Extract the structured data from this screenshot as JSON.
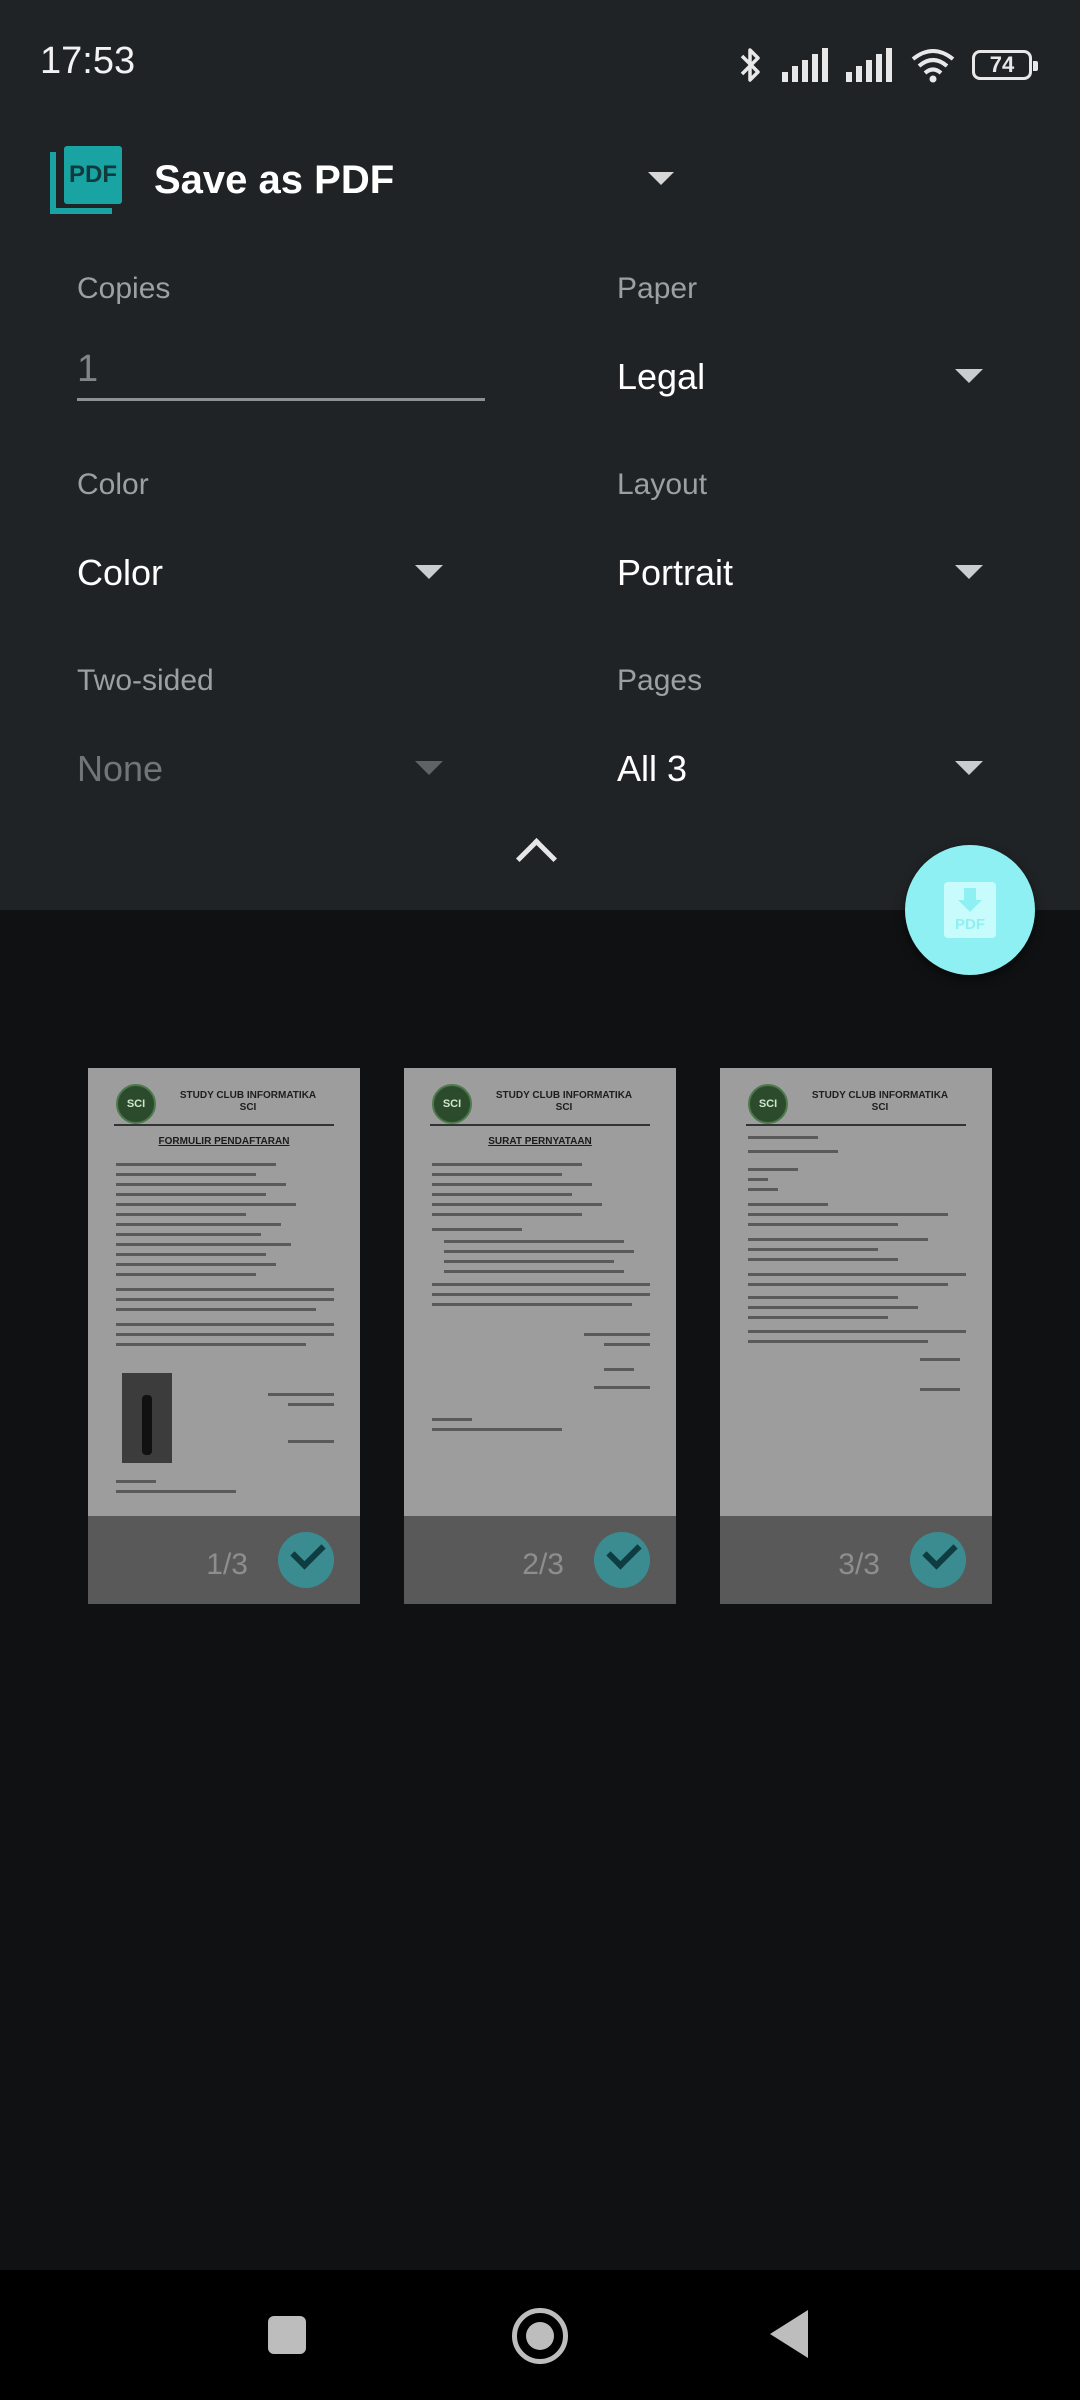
{
  "status_bar": {
    "time": "17:53",
    "battery": "74",
    "icons": [
      "bluetooth-icon",
      "signal-icon",
      "signal-icon",
      "wifi-icon",
      "battery-icon"
    ]
  },
  "printer": {
    "name": "Save as PDF",
    "icon": "pdf-icon"
  },
  "options": {
    "copies": {
      "label": "Copies",
      "value": "1"
    },
    "paper": {
      "label": "Paper",
      "value": "Legal"
    },
    "color": {
      "label": "Color",
      "value": "Color"
    },
    "layout": {
      "label": "Layout",
      "value": "Portrait"
    },
    "two_sided": {
      "label": "Two-sided",
      "value": "None",
      "enabled": false
    },
    "pages": {
      "label": "Pages",
      "value": "All 3"
    }
  },
  "fab": {
    "icon": "download-pdf-icon",
    "text": "PDF"
  },
  "preview": {
    "pages": [
      {
        "number": "1/3",
        "selected": true,
        "org_title": "STUDY CLUB INFORMATIKA",
        "org_subtitle": "SCI",
        "heading": "FORMULIR PENDAFTARAN"
      },
      {
        "number": "2/3",
        "selected": true,
        "org_title": "STUDY CLUB INFORMATIKA",
        "org_subtitle": "SCI",
        "heading": "SURAT PERNYATAAN"
      },
      {
        "number": "3/3",
        "selected": true,
        "org_title": "STUDY CLUB INFORMATIKA",
        "org_subtitle": "SCI",
        "heading": ""
      }
    ],
    "logo_text": "SCI"
  },
  "nav": {
    "recents": "recents-icon",
    "home": "home-icon",
    "back": "back-icon"
  }
}
